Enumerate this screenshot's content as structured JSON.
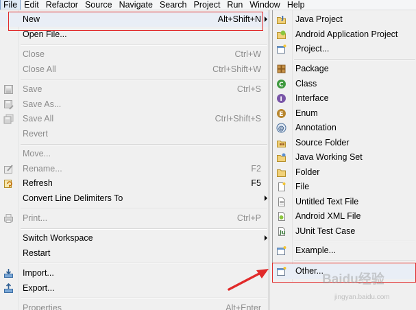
{
  "menubar": [
    "File",
    "Edit",
    "Refactor",
    "Source",
    "Navigate",
    "Search",
    "Project",
    "Run",
    "Window",
    "Help"
  ],
  "file_menu": {
    "new": {
      "label": "New",
      "shortcut": "Alt+Shift+N"
    },
    "open_file": {
      "label": "Open File..."
    },
    "close": {
      "label": "Close",
      "shortcut": "Ctrl+W"
    },
    "close_all": {
      "label": "Close All",
      "shortcut": "Ctrl+Shift+W"
    },
    "save": {
      "label": "Save",
      "shortcut": "Ctrl+S"
    },
    "save_as": {
      "label": "Save As..."
    },
    "save_all": {
      "label": "Save All",
      "shortcut": "Ctrl+Shift+S"
    },
    "revert": {
      "label": "Revert"
    },
    "move": {
      "label": "Move..."
    },
    "rename": {
      "label": "Rename...",
      "shortcut": "F2"
    },
    "refresh": {
      "label": "Refresh",
      "shortcut": "F5"
    },
    "convert": {
      "label": "Convert Line Delimiters To"
    },
    "print": {
      "label": "Print...",
      "shortcut": "Ctrl+P"
    },
    "switch_workspace": {
      "label": "Switch Workspace"
    },
    "restart": {
      "label": "Restart"
    },
    "import": {
      "label": "Import..."
    },
    "export": {
      "label": "Export..."
    },
    "properties": {
      "label": "Properties",
      "shortcut": "Alt+Enter"
    }
  },
  "new_submenu": [
    {
      "label": "Java Project",
      "icon": "java-project-icon"
    },
    {
      "label": "Android Application Project",
      "icon": "android-project-icon"
    },
    {
      "label": "Project...",
      "icon": "project-icon"
    },
    {
      "label": "Package",
      "icon": "package-icon"
    },
    {
      "label": "Class",
      "icon": "class-icon"
    },
    {
      "label": "Interface",
      "icon": "interface-icon"
    },
    {
      "label": "Enum",
      "icon": "enum-icon"
    },
    {
      "label": "Annotation",
      "icon": "annotation-icon"
    },
    {
      "label": "Source Folder",
      "icon": "source-folder-icon"
    },
    {
      "label": "Java Working Set",
      "icon": "working-set-icon"
    },
    {
      "label": "Folder",
      "icon": "folder-icon"
    },
    {
      "label": "File",
      "icon": "file-icon"
    },
    {
      "label": "Untitled Text File",
      "icon": "text-file-icon"
    },
    {
      "label": "Android XML File",
      "icon": "android-xml-icon"
    },
    {
      "label": "JUnit Test Case",
      "icon": "junit-icon"
    },
    {
      "label": "Example...",
      "icon": "example-icon"
    },
    {
      "label": "Other...",
      "icon": "other-wizard-icon"
    }
  ],
  "watermark": {
    "text": "Baidu经验",
    "sub": "jingyan.baidu.com"
  },
  "colors": {
    "annotation": "#e12a2a",
    "highlight": "#e9eef6"
  }
}
